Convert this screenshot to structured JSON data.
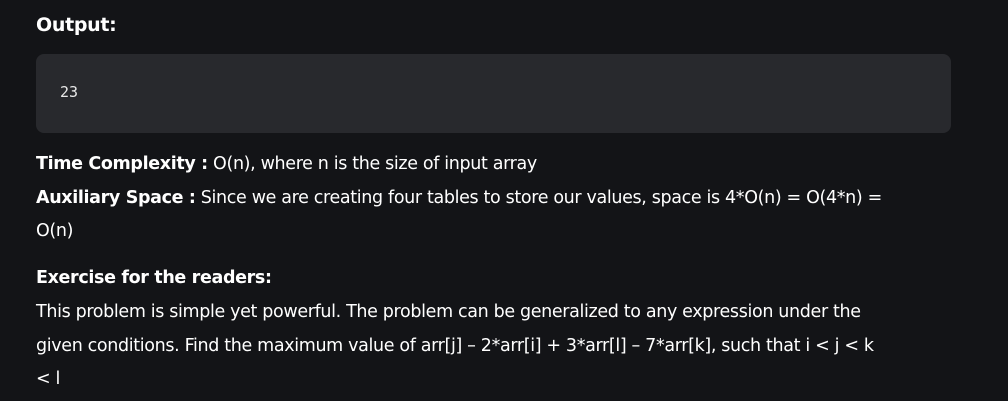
{
  "output": {
    "heading": "Output:",
    "code": "23"
  },
  "time_complexity": {
    "label": "Time Complexity :",
    "value": " O(n), where n is the size of input array"
  },
  "auxiliary_space": {
    "label": "Auxiliary Space :",
    "value_line1": " Since we are creating four tables to store our values, space is 4*O(n) = O(4*n) =",
    "value_line2": "O(n)"
  },
  "exercise": {
    "heading": "Exercise for the readers:",
    "line1": "This problem is simple yet powerful. The problem can be generalized to any expression under the",
    "line2": "given conditions. Find the maximum value of arr[j] – 2*arr[i] + 3*arr[l] – 7*arr[k], such that i < j < k",
    "line3": "< l"
  }
}
